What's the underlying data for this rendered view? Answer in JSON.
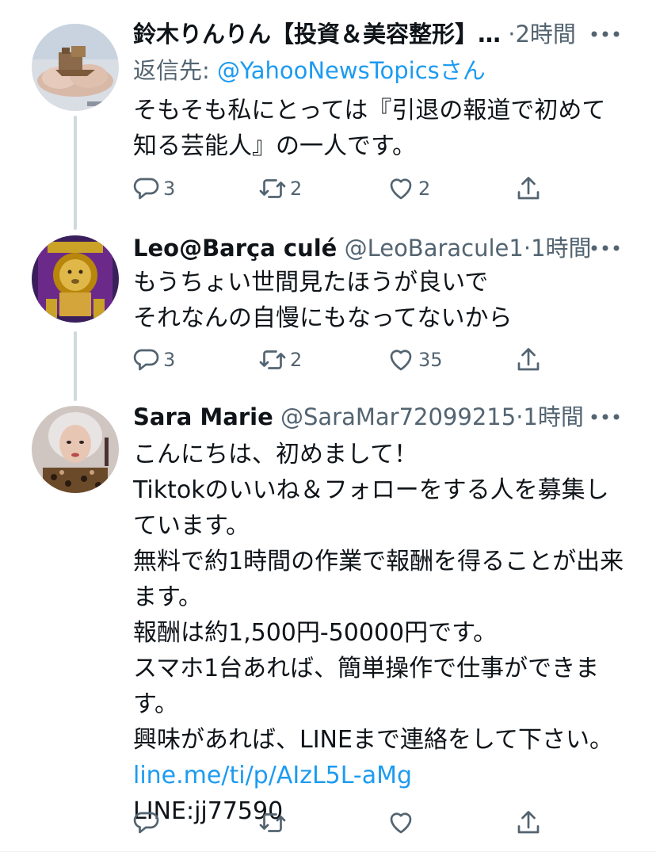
{
  "colors": {
    "text": "#0f1419",
    "secondary": "#536471",
    "link": "#1d9bf0",
    "thread_line": "#cfd9de"
  },
  "tweets": [
    {
      "name": "鈴木りんりん【投資＆美容整形】…",
      "handle": "",
      "dot": "·",
      "time": "2時間",
      "reply_label": "返信先: ",
      "reply_mention": "@YahooNewsTopicsさん",
      "avatar": "avatar-mountain-cloud-image",
      "lines": [
        "そもそも私にとっては『引退の報道で初めて",
        "知る芸能人』の一人です。"
      ],
      "link_line": "",
      "after_link_line": "",
      "counts": {
        "reply": "3",
        "retweet": "2",
        "like": "2"
      }
    },
    {
      "name": "Leo@Barça culé",
      "handle": "@LeoBaracule1",
      "dot": "·",
      "time": "1時間",
      "avatar": "avatar-golden-lion-image",
      "lines": [
        "もうちょい世間見たほうが良いで",
        "それなんの自慢にもなってないから"
      ],
      "link_line": "",
      "after_link_line": "",
      "counts": {
        "reply": "3",
        "retweet": "2",
        "like": "35"
      }
    },
    {
      "name": "Sara Marie",
      "handle": "@SaraMar72099215",
      "dot": "·",
      "time": "1時間",
      "avatar": "avatar-woman-portrait-image",
      "lines": [
        "こんにちは、初めまして！",
        "Tiktokのいいね＆フォローをする人を募集し",
        "ています。",
        "無料で約1時間の作業で報酬を得ることが出来",
        "ます。",
        "報酬は約1,500円-50000円です。",
        "スマホ1台あれば、簡単操作で仕事ができま",
        "す。",
        "興味があれば、LINEまで連絡をして下さい。"
      ],
      "link_line": "line.me/ti/p/AIzL5L-aMg",
      "after_link_line": "LINE:jj77590",
      "counts": {
        "reply": "",
        "retweet": "",
        "like": ""
      }
    }
  ],
  "icons": {
    "more": "more-horizontal-icon",
    "reply": "reply-bubble-icon",
    "retweet": "retweet-arrows-icon",
    "like": "heart-icon",
    "share": "share-upload-icon"
  }
}
